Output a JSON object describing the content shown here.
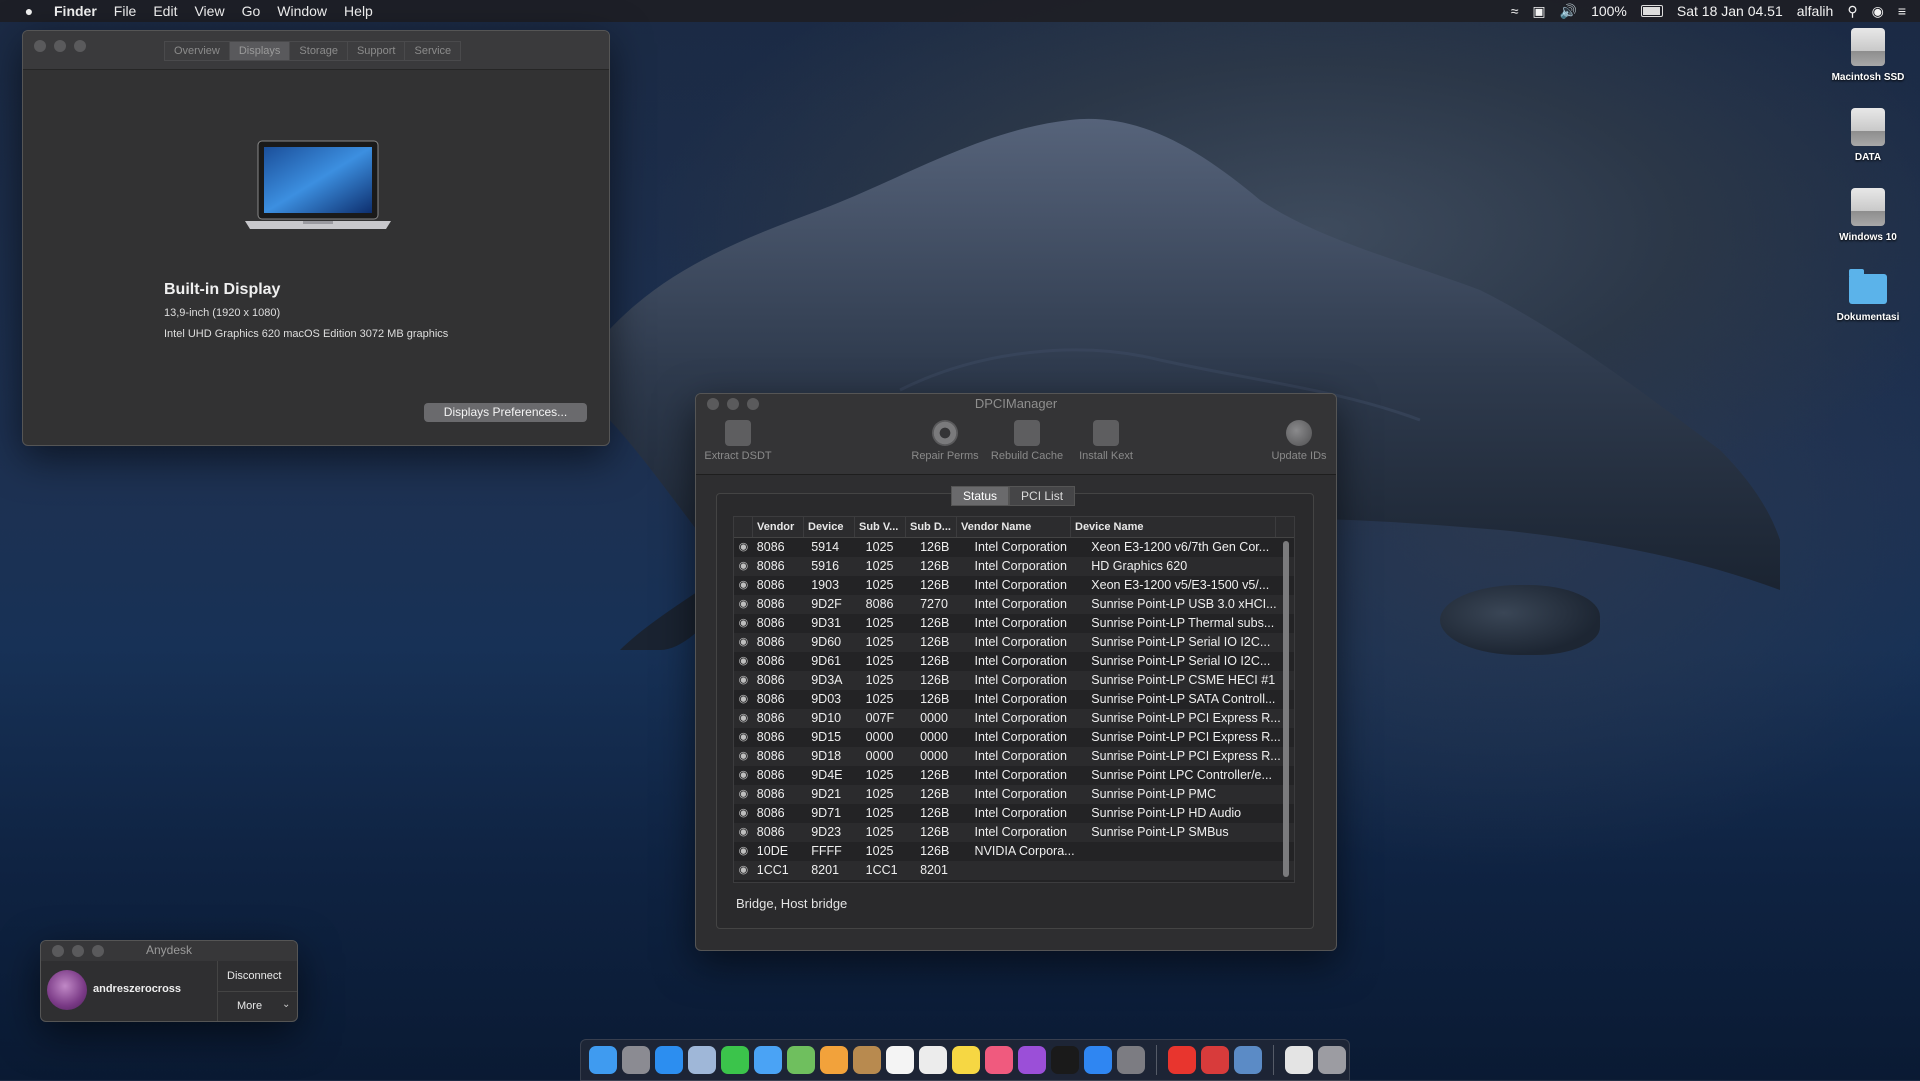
{
  "menubar": {
    "app": "Finder",
    "items": [
      "File",
      "Edit",
      "View",
      "Go",
      "Window",
      "Help"
    ],
    "battery": "100%",
    "clock": "Sat 18 Jan  04.51",
    "user": "alfalih"
  },
  "about": {
    "tabs": [
      "Overview",
      "Displays",
      "Storage",
      "Support",
      "Service"
    ],
    "display_title": "Built-in Display",
    "display_size": "13,9-inch (1920 x 1080)",
    "display_graphics": "Intel UHD Graphics 620 macOS Edition 3072 MB graphics",
    "prefs_button": "Displays Preferences..."
  },
  "desktop": {
    "icons": [
      "Macintosh SSD",
      "DATA",
      "Windows 10",
      "Dokumentasi"
    ]
  },
  "dpci": {
    "title": "DPCIManager",
    "toolbar": {
      "extract": "Extract DSDT",
      "repair": "Repair Perms",
      "rebuild": "Rebuild Cache",
      "install": "Install Kext",
      "update": "Update IDs"
    },
    "tabs": [
      "Status",
      "PCI List"
    ],
    "columns": [
      "Vendor",
      "Device",
      "Sub V...",
      "Sub D...",
      "Vendor Name",
      "Device Name"
    ],
    "rows": [
      [
        "8086",
        "5914",
        "1025",
        "126B",
        "Intel Corporation",
        "Xeon E3-1200 v6/7th Gen Cor..."
      ],
      [
        "8086",
        "5916",
        "1025",
        "126B",
        "Intel Corporation",
        "HD Graphics 620"
      ],
      [
        "8086",
        "1903",
        "1025",
        "126B",
        "Intel Corporation",
        "Xeon E3-1200 v5/E3-1500 v5/..."
      ],
      [
        "8086",
        "9D2F",
        "8086",
        "7270",
        "Intel Corporation",
        "Sunrise Point-LP USB 3.0 xHCI..."
      ],
      [
        "8086",
        "9D31",
        "1025",
        "126B",
        "Intel Corporation",
        "Sunrise Point-LP Thermal subs..."
      ],
      [
        "8086",
        "9D60",
        "1025",
        "126B",
        "Intel Corporation",
        "Sunrise Point-LP Serial IO I2C..."
      ],
      [
        "8086",
        "9D61",
        "1025",
        "126B",
        "Intel Corporation",
        "Sunrise Point-LP Serial IO I2C..."
      ],
      [
        "8086",
        "9D3A",
        "1025",
        "126B",
        "Intel Corporation",
        "Sunrise Point-LP CSME HECI #1"
      ],
      [
        "8086",
        "9D03",
        "1025",
        "126B",
        "Intel Corporation",
        "Sunrise Point-LP SATA Controll..."
      ],
      [
        "8086",
        "9D10",
        "007F",
        "0000",
        "Intel Corporation",
        "Sunrise Point-LP PCI Express R..."
      ],
      [
        "8086",
        "9D15",
        "0000",
        "0000",
        "Intel Corporation",
        "Sunrise Point-LP PCI Express R..."
      ],
      [
        "8086",
        "9D18",
        "0000",
        "0000",
        "Intel Corporation",
        "Sunrise Point-LP PCI Express R..."
      ],
      [
        "8086",
        "9D4E",
        "1025",
        "126B",
        "Intel Corporation",
        "Sunrise Point LPC Controller/e..."
      ],
      [
        "8086",
        "9D21",
        "1025",
        "126B",
        "Intel Corporation",
        "Sunrise Point-LP PMC"
      ],
      [
        "8086",
        "9D71",
        "1025",
        "126B",
        "Intel Corporation",
        "Sunrise Point-LP HD Audio"
      ],
      [
        "8086",
        "9D23",
        "1025",
        "126B",
        "Intel Corporation",
        "Sunrise Point-LP SMBus"
      ],
      [
        "10DE",
        "FFFF",
        "1025",
        "126B",
        "NVIDIA Corpora...",
        ""
      ],
      [
        "1CC1",
        "8201",
        "1CC1",
        "8201",
        "",
        ""
      ]
    ],
    "status": "Bridge, Host bridge"
  },
  "anydesk": {
    "title": "Anydesk",
    "user": "andreszerocross",
    "disconnect": "Disconnect",
    "more": "More"
  },
  "colors": {
    "accent": "#5bb3ea",
    "window_bg": "#323233"
  }
}
